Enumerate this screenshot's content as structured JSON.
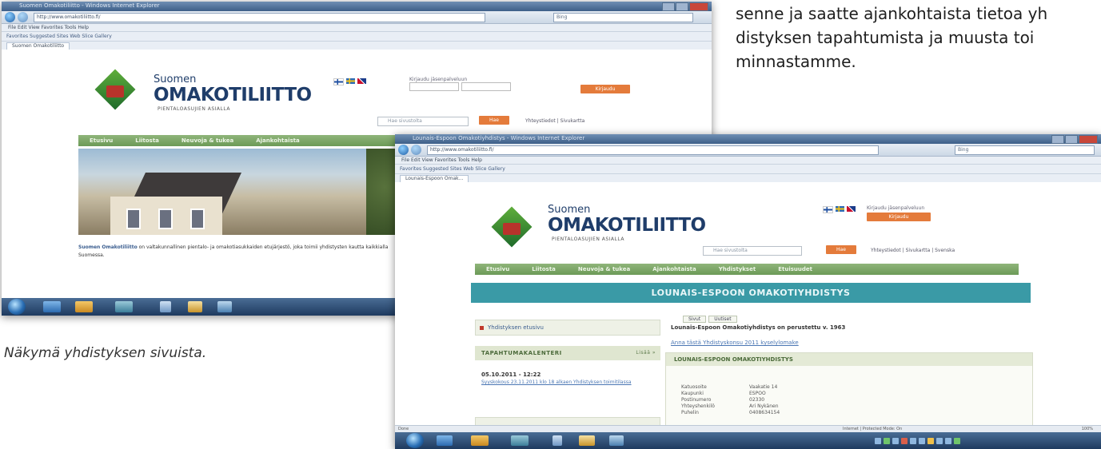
{
  "body_text": {
    "line1": "senne ja saatte ajankohtaista tietoa yh",
    "line2": "distyksen tapahtumista ja muusta toi",
    "line3": "minnastamme."
  },
  "caption": "Näkymä yhdistyksen sivuista.",
  "logo": {
    "small": "Suomen",
    "big": "OMAKOTILIITTO",
    "sub": "PIENTALOASUJIEN ASIALLA"
  },
  "back_window": {
    "title": "Suomen Omakotiliitto - Windows Internet Explorer",
    "address": "http://www.omakotiliitto.fi/",
    "search_placeholder": "Bing",
    "menu": "File   Edit   View   Favorites   Tools   Help",
    "favorites": "Favorites      Suggested Sites      Web Slice Gallery",
    "tab_label": "Suomen Omakotiliitto",
    "login_label": "Kirjaudu jäsenpalveluun",
    "site_search_placeholder": "Hae sivustolta",
    "search_btn": "Hae",
    "top_links": "Yhteystiedot  |  Sivukartta",
    "login_btn": "Kirjaudu",
    "nav": [
      "Etusivu",
      "Liitosta",
      "Neuvoja & tukea",
      "Ajankohtaista"
    ],
    "intro_bold": "Suomen Omakotiliitto",
    "intro_rest": "on valtakunnallinen pientalo- ja omakotiasukkaiden etujärjestö, joka toimii yhdistysten kautta kaikkialla Suomessa."
  },
  "front_window": {
    "title": "Lounais-Espoon Omakotiyhdistys - Windows Internet Explorer",
    "address": "http://www.omakotiliitto.fi/",
    "search_placeholder": "Bing",
    "menu": "File   Edit   View   Favorites   Tools   Help",
    "favorites": "Favorites      Suggested Sites      Web Slice Gallery",
    "tab_label": "Lounais-Espoon Omak...",
    "member_label": "Kirjaudu jäsenpalveluun",
    "member_btn": "Kirjaudu",
    "site_search_placeholder": "Hae sivustolta",
    "search_btn": "Hae",
    "top_links": "Yhteystiedot  |  Sivukartta  |  Svenska",
    "nav": [
      "Etusivu",
      "Liitosta",
      "Neuvoja & tukea",
      "Ajankohtaista",
      "Yhdistykset",
      "Etuisuudet"
    ],
    "teal_title": "LOUNAIS-ESPOON OMAKOTIYHDISTYS",
    "left_link": "Yhdistyksen etusivu",
    "calendar_head": "TAPAHTUMAKALENTERI",
    "calendar_more": "Lisää »",
    "event_date": "05.10.2011 - 12:22",
    "event_text": "Syyskokous 23.11.2011 klo 18 alkaen Yhdistyksen toimitilassa",
    "tabs": [
      "Sivut",
      "Uutiset"
    ],
    "founded": "Lounais-Espoon Omakotiyhdistys on perustettu v. 1963",
    "news_link": "Anna tästä Yhdistyskonsu 2011 kyselylomake",
    "info_head": "LOUNAIS-ESPOON OMAKOTIYHDISTYS",
    "info": [
      {
        "k": "Katuosoite",
        "v": "Vaakatie 14"
      },
      {
        "k": "Kaupunki",
        "v": "ESPOO"
      },
      {
        "k": "Postinumero",
        "v": "02330"
      },
      {
        "k": "Yhteyshenkilö",
        "v": "Ari Nykänen"
      },
      {
        "k": "Puhelin",
        "v": "0408634154"
      }
    ],
    "status_left": "Done",
    "status_right": "Internet | Protected Mode: On",
    "zoom": "100%"
  },
  "colors": {
    "teal": "#3a9aa6",
    "green_nav": "#7ba766",
    "orange_button": "#e47b3b",
    "logo_green": "#3f8c33",
    "logo_blue": "#1f3d6a"
  }
}
